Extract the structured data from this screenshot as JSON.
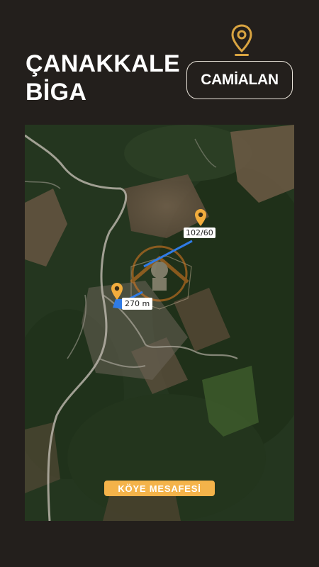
{
  "header": {
    "title_line1": "ÇANAKKALE",
    "title_line2": "BİGA",
    "location_badge": "CAMİALAN",
    "pin_icon": "map-pin-icon"
  },
  "map": {
    "parcel_label": "102/60",
    "distance_label": "270 m",
    "village_distance_label": "KÖYE MESAFESİ",
    "pin_icon": "map-pin-icon"
  },
  "colors": {
    "background": "#231f1c",
    "accent": "#f4b34a",
    "pin": "#f2ad3d",
    "route": "#2f7be6",
    "text": "#ffffff"
  }
}
